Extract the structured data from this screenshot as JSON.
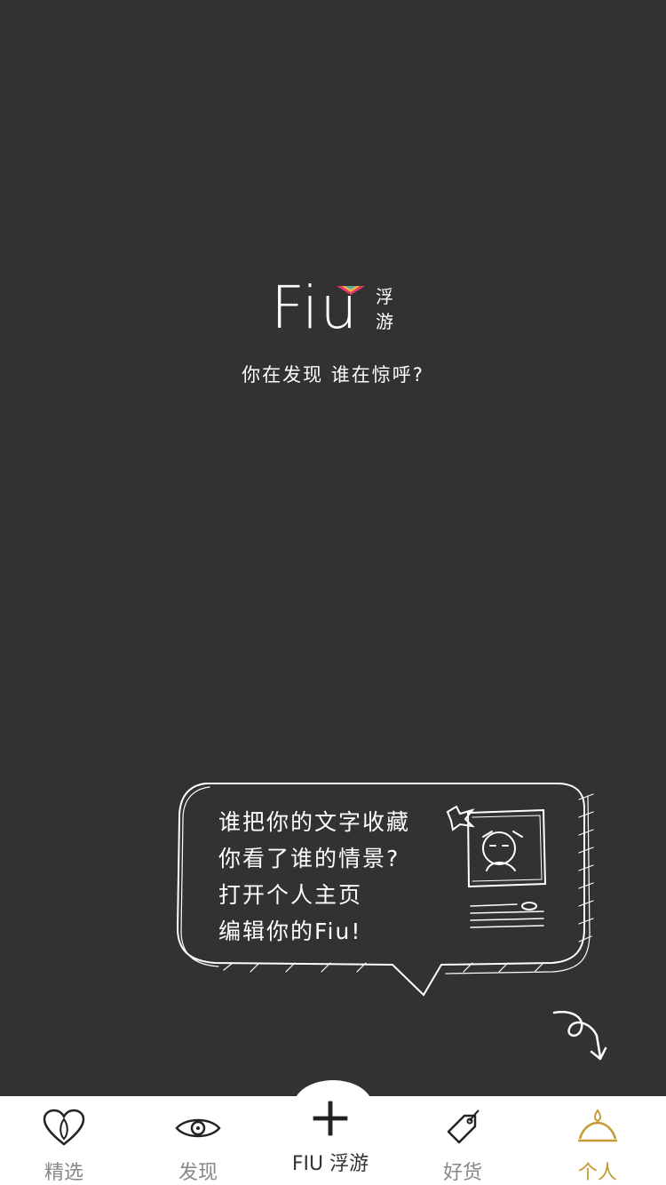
{
  "logo": {
    "wordmark": "Fiu",
    "cn_line1": "浮",
    "cn_line2": "游"
  },
  "tagline": "你在发现 谁在惊呼?",
  "bubble": {
    "lines": [
      "谁把你的文字收藏",
      "你看了谁的情景?",
      "打开个人主页",
      "编辑你的Fiu!"
    ]
  },
  "tabbar": {
    "active_color": "#c59a32",
    "inactive_color": "#888888",
    "items": [
      {
        "label": "精选",
        "icon": "heart-icon"
      },
      {
        "label": "发现",
        "icon": "eye-icon"
      },
      {
        "label": "FIU 浮游",
        "icon": "plus-icon"
      },
      {
        "label": "好货",
        "icon": "tag-icon"
      },
      {
        "label": "个人",
        "icon": "person-icon"
      }
    ],
    "active_index": 4
  }
}
